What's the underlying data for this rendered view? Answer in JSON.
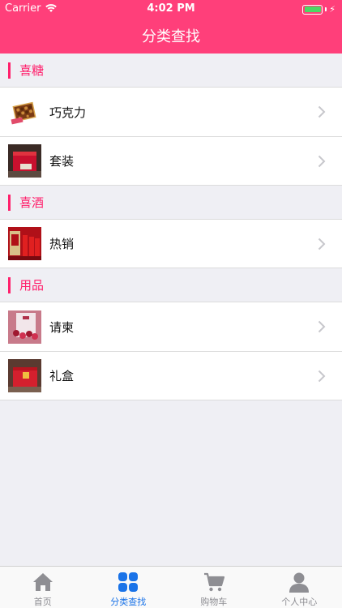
{
  "status_bar": {
    "carrier": "Carrier",
    "time": "4:02 PM"
  },
  "header": {
    "title": "分类查找"
  },
  "colors": {
    "brand": "#ff3f7a",
    "accent": "#ff1f6b",
    "active_tab": "#1a73e8",
    "inactive_tab": "#8e8e93"
  },
  "sections": [
    {
      "title": "喜糖",
      "items": [
        {
          "label": "巧克力",
          "icon": "chocolate-box-thumbnail"
        },
        {
          "label": "套装",
          "icon": "gift-set-thumbnail"
        }
      ]
    },
    {
      "title": "喜酒",
      "items": [
        {
          "label": "热销",
          "icon": "wine-bottles-thumbnail"
        }
      ]
    },
    {
      "title": "用品",
      "items": [
        {
          "label": "请柬",
          "icon": "invitation-card-thumbnail"
        },
        {
          "label": "礼盒",
          "icon": "gift-box-thumbnail"
        }
      ]
    }
  ],
  "tabbar": {
    "tabs": [
      {
        "label": "首页",
        "icon": "home-icon"
      },
      {
        "label": "分类查找",
        "icon": "category-grid-icon",
        "active": true
      },
      {
        "label": "购物车",
        "icon": "cart-icon"
      },
      {
        "label": "个人中心",
        "icon": "person-icon"
      }
    ]
  }
}
